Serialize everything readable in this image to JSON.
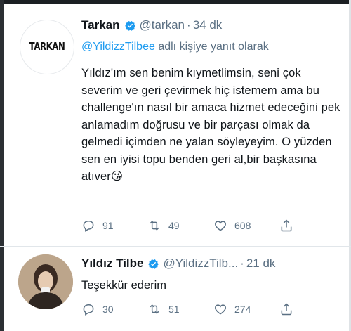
{
  "tweets": [
    {
      "avatar_logo_text": "TARKAN",
      "name": "Tarkan",
      "verified": true,
      "handle": "@tarkan",
      "separator": "·",
      "time": "34 dk",
      "reply_to_handle": "@YildizzTilbee",
      "reply_suffix": "adlı kişiye yanıt olarak",
      "text": "Yıldız'ım sen benim kıymetlimsin, seni çok severim ve geri çevirmek hiç istemem ama bu challenge'ın nasıl bir amaca hizmet edeceğini pek anlamadım doğrusu ve bir parçası olmak da gelmedi içimden ne yalan söyleyeyim. O yüzden sen en iyisi topu benden geri al,bir başkasına atıver😘",
      "reply_count": "91",
      "retweet_count": "49",
      "like_count": "608"
    },
    {
      "name": "Yıldız Tilbe",
      "verified": true,
      "handle": "@YildizzTilb...",
      "separator": "·",
      "time": "21 dk",
      "text": "Teşekkür ederim",
      "reply_count": "30",
      "retweet_count": "51",
      "like_count": "274"
    }
  ],
  "colors": {
    "accent": "#1d9bf0",
    "muted": "#5b7083",
    "text": "#0f1419"
  },
  "icons": [
    "reply-icon",
    "retweet-icon",
    "like-icon",
    "share-icon",
    "verified-badge-icon"
  ]
}
